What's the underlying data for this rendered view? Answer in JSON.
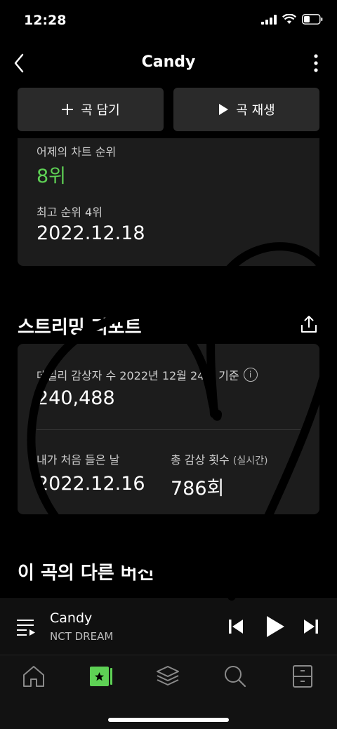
{
  "status": {
    "time": "12:28"
  },
  "header": {
    "title": "Candy"
  },
  "actions": {
    "add_label": "곡 담기",
    "play_label": "곡 재생"
  },
  "chart": {
    "yesterday_label": "어제의 차트 순위",
    "yesterday_rank": "8위",
    "best_label": "최고 순위 4위",
    "best_date": "2022.12.18"
  },
  "report": {
    "title": "스트리밍 리포트",
    "daily_label": "데일리 감상자 수 2022년 12월 24일 기준",
    "daily_value": "240,488",
    "first_label": "내가 처음 들은 날",
    "first_value": "2022.12.16",
    "total_label": "총 감상 횟수",
    "total_sub": "(실시간)",
    "total_value": "786회"
  },
  "versions": {
    "title": "이 곡의 다른 버전"
  },
  "player": {
    "title": "Candy",
    "artist": "NCT DREAM"
  },
  "tabs": [
    "home-icon",
    "library-icon",
    "layers-icon",
    "search-icon",
    "storage-icon"
  ],
  "colors": {
    "accent": "#5ed155",
    "background": "#000000",
    "card": "#1c1c1c"
  }
}
